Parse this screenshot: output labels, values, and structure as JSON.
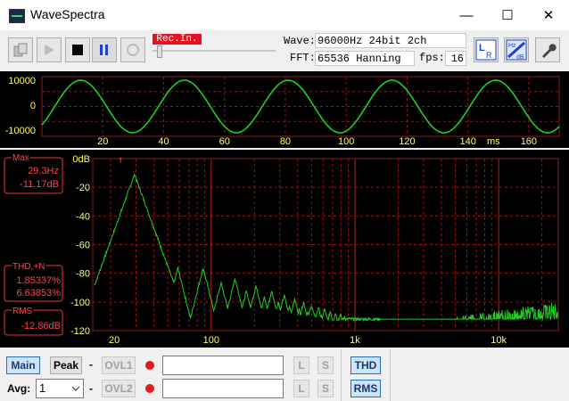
{
  "window": {
    "title": "WaveSpectra",
    "minimize": "—",
    "maximize": "☐",
    "close": "✕"
  },
  "toolbar": {
    "rec_indicator": "Rec.In.",
    "wave_label": "Wave:",
    "wave_value": "96000Hz 24bit 2ch",
    "fft_label": "FFT:",
    "fft_value": "65536 Hanning",
    "fps_label": "fps:",
    "fps_value": "16",
    "lr_icon": "L R",
    "hz_db_icon_top": "Hz",
    "hz_db_icon_bottom": "dB",
    "colors": {
      "rec_bg": "#e81123",
      "rec_text": "#ffffff"
    }
  },
  "wave": {
    "y_ticks": [
      "10000",
      "0",
      "-10000"
    ],
    "x_ticks": [
      "20",
      "40",
      "60",
      "80",
      "100",
      "120",
      "140",
      "160"
    ],
    "x_unit": "ms",
    "colors": {
      "trace": "#22cc22",
      "grid": "#8a1a1a",
      "tick": "#ffff66"
    }
  },
  "spectrum": {
    "y_ticks": [
      "0dB",
      "-20",
      "-40",
      "-60",
      "-80",
      "-100",
      "-120"
    ],
    "x_ticks": [
      "20",
      "100",
      "1k",
      "10k"
    ],
    "max_box": {
      "title": "Max",
      "freq": "29.3Hz",
      "level": "-11.17dB"
    },
    "thd_box": {
      "title": "THD,+N",
      "value1": "1.85337%",
      "value2": "6.63853%"
    },
    "rms_box": {
      "title": "RMS",
      "value": "-12.86dB"
    },
    "peak_marker": "f",
    "colors": {
      "trace": "#22cc22",
      "grid": "#8a1a1a",
      "box": "#e33",
      "tick": "#ffff66"
    }
  },
  "bottom": {
    "main_label": "Main",
    "peak_label": "Peak",
    "dash": "-",
    "ovl1_label": "OVL1",
    "ovl2_label": "OVL2",
    "l_label": "L",
    "s_label": "S",
    "thd_label": "THD",
    "rms_label": "RMS",
    "avg_label": "Avg:",
    "avg_value": "1"
  }
}
